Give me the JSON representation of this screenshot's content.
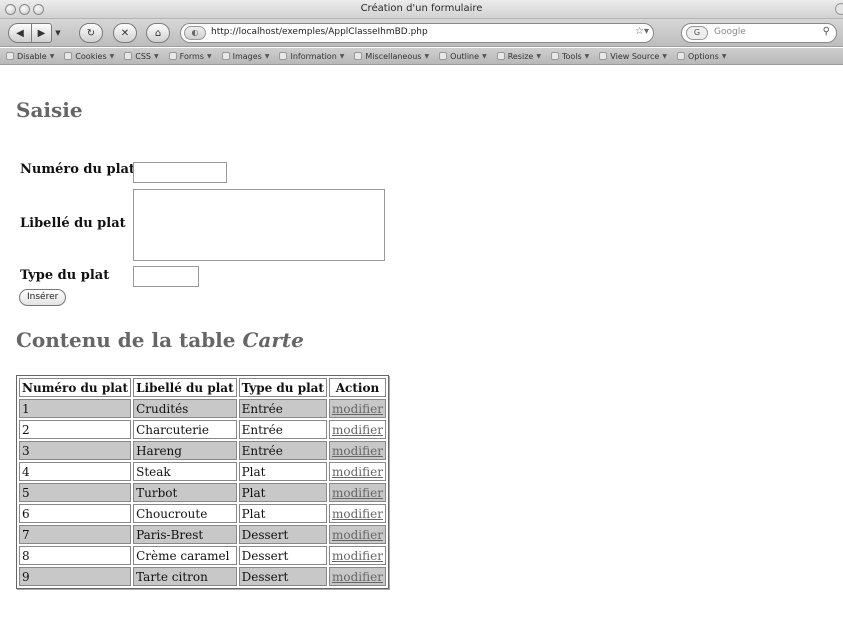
{
  "window": {
    "title": "Création d'un formulaire"
  },
  "toolbar": {
    "url": "http://localhost/exemples/ApplClasseIhmBD.php",
    "search_engine": "G",
    "search_placeholder": "Google"
  },
  "devbar": {
    "items": [
      "Disable",
      "Cookies",
      "CSS",
      "Forms",
      "Images",
      "Information",
      "Miscellaneous",
      "Outline",
      "Resize",
      "Tools",
      "View Source",
      "Options"
    ]
  },
  "form": {
    "heading": "Saisie",
    "numero_label": "Numéro du plat",
    "libelle_label": "Libellé du plat",
    "type_label": "Type du plat",
    "numero_value": "",
    "libelle_value": "",
    "type_value": "",
    "submit_label": "Insérer"
  },
  "table_section": {
    "heading_prefix": "Contenu de la table ",
    "heading_em": "Carte"
  },
  "table": {
    "headers": [
      "Numéro du plat",
      "Libellé du plat",
      "Type du plat",
      "Action"
    ],
    "rows": [
      [
        "1",
        "Crudités",
        "Entrée",
        "modifier"
      ],
      [
        "2",
        "Charcuterie",
        "Entrée",
        "modifier"
      ],
      [
        "3",
        "Hareng",
        "Entrée",
        "modifier"
      ],
      [
        "4",
        "Steak",
        "Plat",
        "modifier"
      ],
      [
        "5",
        "Turbot",
        "Plat",
        "modifier"
      ],
      [
        "6",
        "Choucroute",
        "Plat",
        "modifier"
      ],
      [
        "7",
        "Paris-Brest",
        "Dessert",
        "modifier"
      ],
      [
        "8",
        "Crème caramel",
        "Dessert",
        "modifier"
      ],
      [
        "9",
        "Tarte citron",
        "Dessert",
        "modifier"
      ]
    ]
  }
}
